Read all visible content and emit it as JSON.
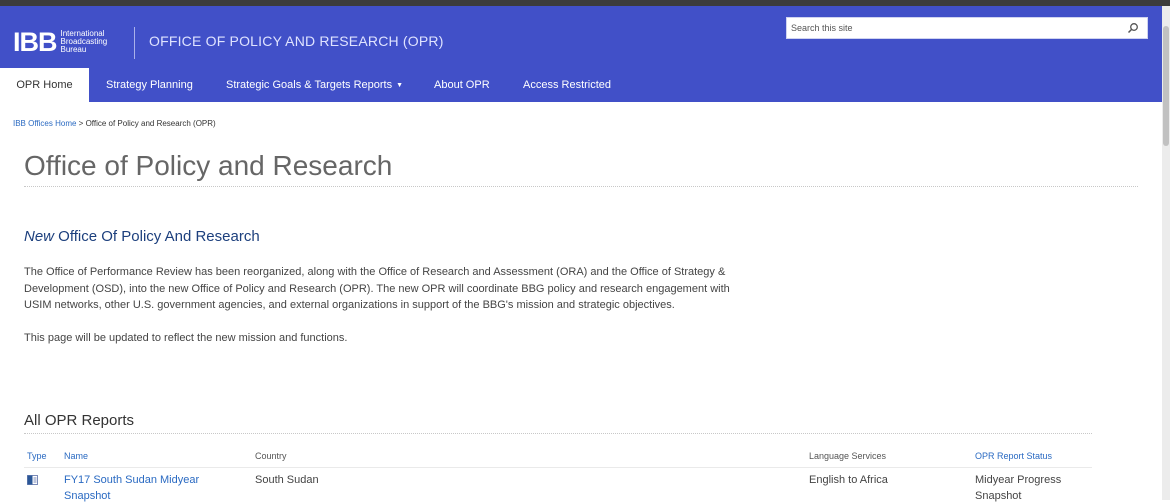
{
  "header": {
    "logo": {
      "mark": "IBB",
      "line1": "International",
      "line2": "Broadcasting",
      "line3": "Bureau"
    },
    "site_title": "OFFICE OF POLICY AND RESEARCH (OPR)",
    "search_placeholder": "Search this site",
    "brand_color": "#4150c8"
  },
  "nav": {
    "items": [
      {
        "label": "OPR Home",
        "active": true
      },
      {
        "label": "Strategy Planning"
      },
      {
        "label": "Strategic Goals & Targets Reports",
        "has_dropdown": true
      },
      {
        "label": "About OPR"
      },
      {
        "label": "Access Restricted"
      }
    ]
  },
  "breadcrumb": {
    "home": "IBB Offices Home",
    "separator": " > ",
    "current": "Office of Policy and Research (OPR)"
  },
  "main": {
    "title": "Office of Policy and Research",
    "subhead_new": "New",
    "subhead_rest": " Office Of Policy And Research",
    "paragraph1": "The Office of Performance Review has been reorganized, along with the Office of Research and Assessment (ORA) and the Office of Strategy & Development (OSD), into the new Office of Policy and Research (OPR).  The new OPR will coordinate BBG policy and research engagement with USIM networks, other U.S. government agencies, and external organizations in support of the BBG's mission and strategic objectives.",
    "paragraph2": "This page will be updated to reflect the new mission and functions."
  },
  "reports": {
    "title": "All OPR Reports",
    "columns": [
      "Type",
      "Name",
      "Country",
      "Language Services",
      "OPR Report Status"
    ],
    "rows": [
      {
        "type_icon": "word-document-icon",
        "name": "FY17 South Sudan Midyear Snapshot",
        "country": "South Sudan",
        "language_services": "English to Africa",
        "status": "Midyear Progress Snapshot"
      }
    ]
  }
}
